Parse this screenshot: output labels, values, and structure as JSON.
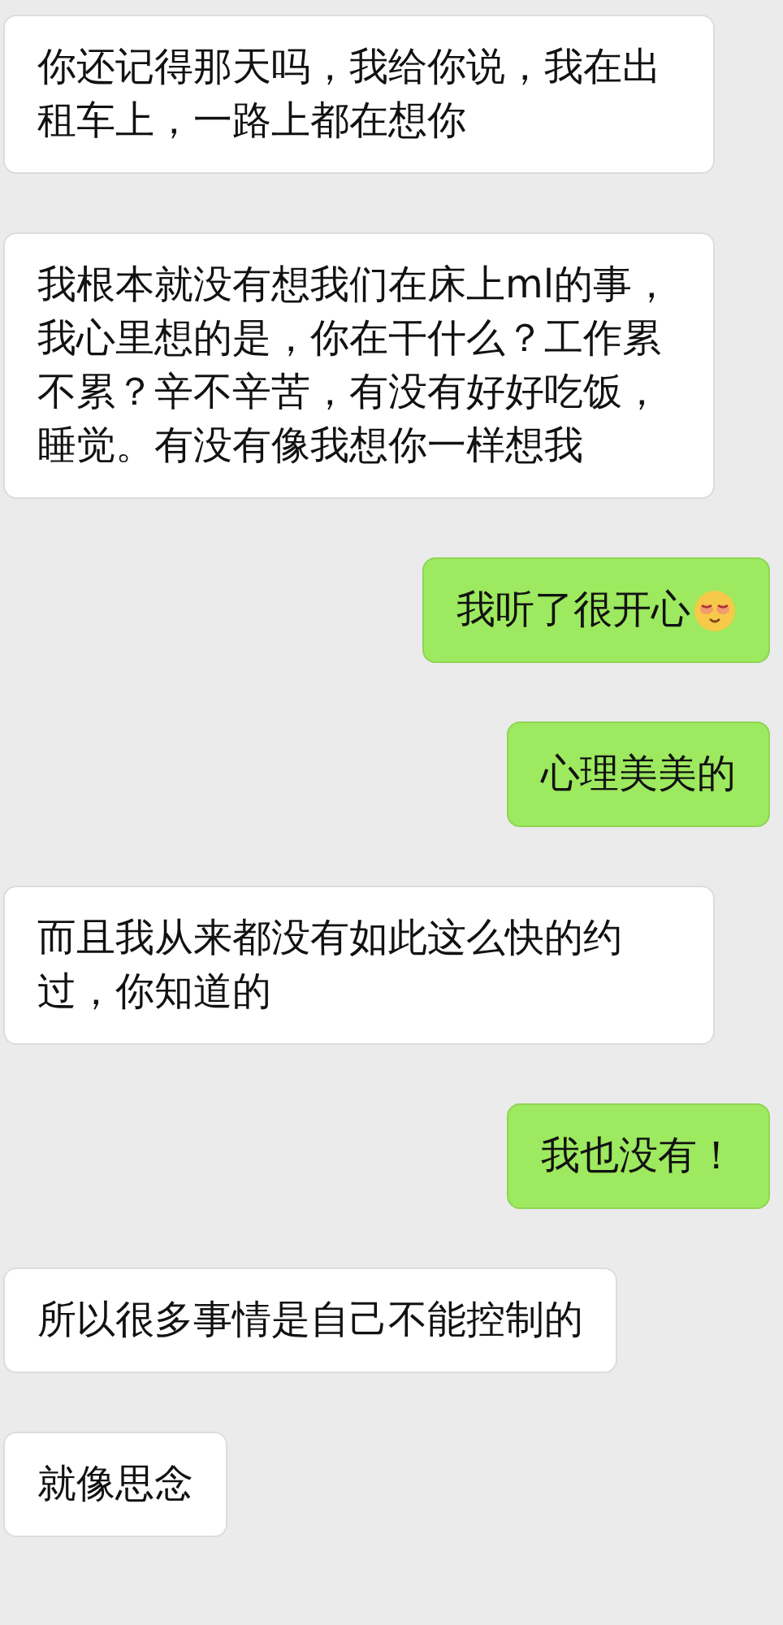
{
  "messages": [
    {
      "kind": "incoming",
      "text": "你还记得那天吗，我给你说，我在出租车上，一路上都在想你",
      "emoji": false
    },
    {
      "kind": "incoming",
      "text": "我根本就没有想我们在床上ml的事，我心里想的是，你在干什么？工作累不累？辛不辛苦，有没有好好吃饭，睡觉。有没有像我想你一样想我",
      "emoji": false
    },
    {
      "kind": "outgoing",
      "text": "我听了很开心",
      "emoji": true
    },
    {
      "kind": "outgoing",
      "text": "心理美美的",
      "emoji": false
    },
    {
      "kind": "incoming",
      "text": "而且我从来都没有如此这么快的约过，你知道的",
      "emoji": false
    },
    {
      "kind": "outgoing",
      "text": "我也没有！",
      "emoji": false
    },
    {
      "kind": "incoming",
      "text": "所以很多事情是自己不能控制的",
      "emoji": false
    },
    {
      "kind": "incoming",
      "text": "就像思念",
      "emoji": false
    }
  ]
}
